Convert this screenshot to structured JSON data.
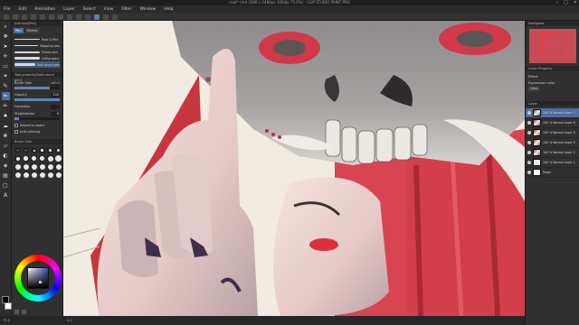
{
  "window": {
    "title": "coat* (m4 3300 x 2480px 300dpi 75.0%) - CLIP STUDIO PAINT PRO",
    "controls": [
      "–",
      "□",
      "✕"
    ]
  },
  "menu": [
    "File",
    "Edit",
    "Animation",
    "Layer",
    "Select",
    "View",
    "Filter",
    "Window",
    "Help"
  ],
  "sub_tool": {
    "header": "Sub tool[Pen]",
    "tabs": [
      "Pen",
      "Marker"
    ],
    "brushes": [
      "Real G-Pen",
      "Mapping pen",
      "Turnip pen",
      "Calligraphy",
      "Soft-round pen"
    ]
  },
  "tool_property": {
    "header": "Tool property[Soft-round pen]",
    "brush_size_label": "Brush Size",
    "brush_size_value": "100.0",
    "brush_size_fill": 0.78,
    "opacity_label": "Opacity",
    "opacity_value": "100",
    "opacity_fill": 1.0,
    "hardness_label": "Hardness",
    "stabilization_label": "Stabilization",
    "stabilization_value": "6",
    "stabilization_fill": 0.1,
    "vector_label": "Adjust to zoom",
    "ink_label": "Anti-aliasing"
  },
  "brush_size_panel": {
    "header": "Brush Size"
  },
  "status": {
    "zoom": "75.0",
    "angle": "0.0"
  },
  "navigator": {
    "header": "Navigator"
  },
  "layer_property": {
    "header": "Layer Property",
    "effect_label": "Effect",
    "expression_label": "Expression color",
    "expression_value": "Color"
  },
  "layers": {
    "header": "Layer",
    "items": [
      {
        "name": "100 % Normal Layer 3",
        "selected": true
      },
      {
        "name": "100 % Normal Layer 6",
        "selected": false
      },
      {
        "name": "100 % Normal Layer 5",
        "selected": false
      },
      {
        "name": "100 % Normal Layer 4",
        "selected": false
      },
      {
        "name": "100 % Normal Layer 2",
        "selected": false
      },
      {
        "name": "100 % Normal Layer 1",
        "selected": false
      },
      {
        "name": "Paper",
        "selected": false
      }
    ]
  },
  "colors": {
    "accent": "#4d6e99",
    "main_color": "#000000",
    "sub_color": "#ffffff"
  }
}
